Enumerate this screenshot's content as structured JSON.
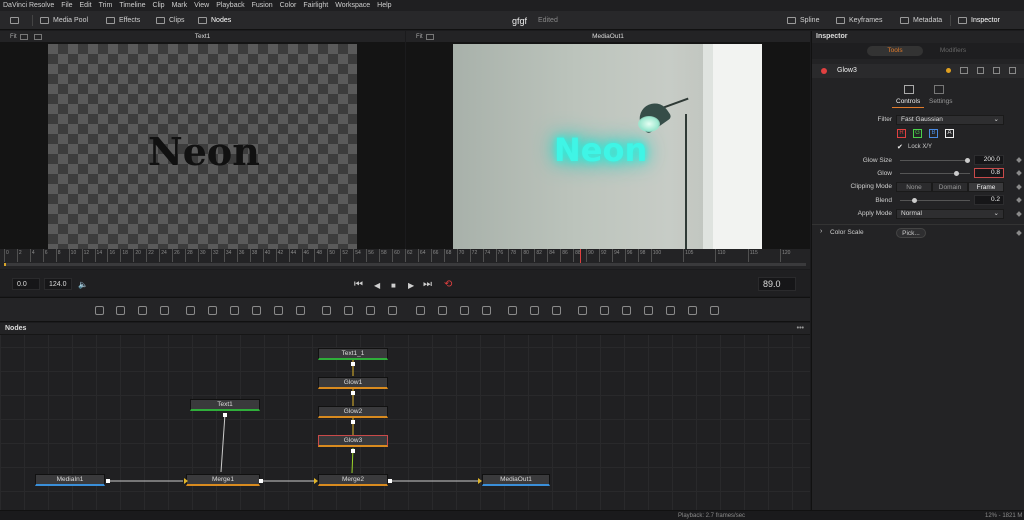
{
  "menu": [
    "DaVinci Resolve",
    "File",
    "Edit",
    "Trim",
    "Timeline",
    "Clip",
    "Mark",
    "View",
    "Playback",
    "Fusion",
    "Color",
    "Fairlight",
    "Workspace",
    "Help"
  ],
  "toolbar": {
    "media_pool": "Media Pool",
    "effects": "Effects",
    "clips": "Clips",
    "nodes": "Nodes",
    "project_name": "gfgf",
    "project_status": "Edited",
    "spline": "Spline",
    "keyframes": "Keyframes",
    "metadata": "Metadata",
    "inspector": "Inspector"
  },
  "viewer_left": {
    "fit": "Fit",
    "title": "Text1",
    "text": "Neon"
  },
  "viewer_right": {
    "fit": "Fit",
    "title": "MediaOut1",
    "text": "Neon"
  },
  "scrubber": {
    "ticks": [
      "0",
      "2",
      "4",
      "6",
      "8",
      "10",
      "12",
      "14",
      "16",
      "18",
      "20",
      "22",
      "24",
      "26",
      "28",
      "30",
      "32",
      "34",
      "36",
      "38",
      "40",
      "42",
      "44",
      "46",
      "48",
      "50",
      "52",
      "54",
      "56",
      "58",
      "60",
      "62",
      "64",
      "66",
      "68",
      "70",
      "72",
      "74",
      "76",
      "78",
      "80",
      "82",
      "84",
      "86",
      "88",
      "90",
      "92",
      "94",
      "96",
      "98",
      "100",
      "105",
      "110",
      "115",
      "120"
    ],
    "playhead": 89
  },
  "transport": {
    "start": "0.0",
    "end": "124.0",
    "current": "89.0"
  },
  "nodes_panel": {
    "title": "Nodes"
  },
  "nodes": {
    "text1_1": "Text1_1",
    "glow1": "Glow1",
    "glow2": "Glow2",
    "glow3": "Glow3",
    "text1": "Text1",
    "mediain1": "MediaIn1",
    "merge1": "Merge1",
    "merge2": "Merge2",
    "mediaout1": "MediaOut1"
  },
  "status": {
    "playback": "Playback: 2.7 frames/sec",
    "memory": "12% - 1821 M"
  },
  "inspector": {
    "title": "Inspector",
    "tab_tools": "Tools",
    "tab_modifiers": "Modifiers",
    "node_name": "Glow3",
    "controls": "Controls",
    "settings": "Settings",
    "filter_label": "Filter",
    "filter_value": "Fast Gaussian",
    "channels": [
      "R",
      "G",
      "B",
      "A"
    ],
    "lock_xy": "Lock X/Y",
    "glow_size_label": "Glow Size",
    "glow_size_value": "200.0",
    "glow_size_fraction": 0.95,
    "glow_label": "Glow",
    "glow_value": "0.8",
    "glow_fraction": 0.8,
    "clipping_label": "Clipping Mode",
    "clipping_options": [
      "None",
      "Domain",
      "Frame"
    ],
    "clipping_selected": "Frame",
    "blend_label": "Blend",
    "blend_value": "0.2",
    "blend_fraction": 0.2,
    "apply_mode_label": "Apply Mode",
    "apply_mode_value": "Normal",
    "color_scale_label": "Color Scale",
    "pick_label": "Pick..."
  },
  "colors": {
    "accent_orange": "#d98b1f",
    "glow_cyan": "#3ff5e6",
    "red": "#c94a4a"
  }
}
